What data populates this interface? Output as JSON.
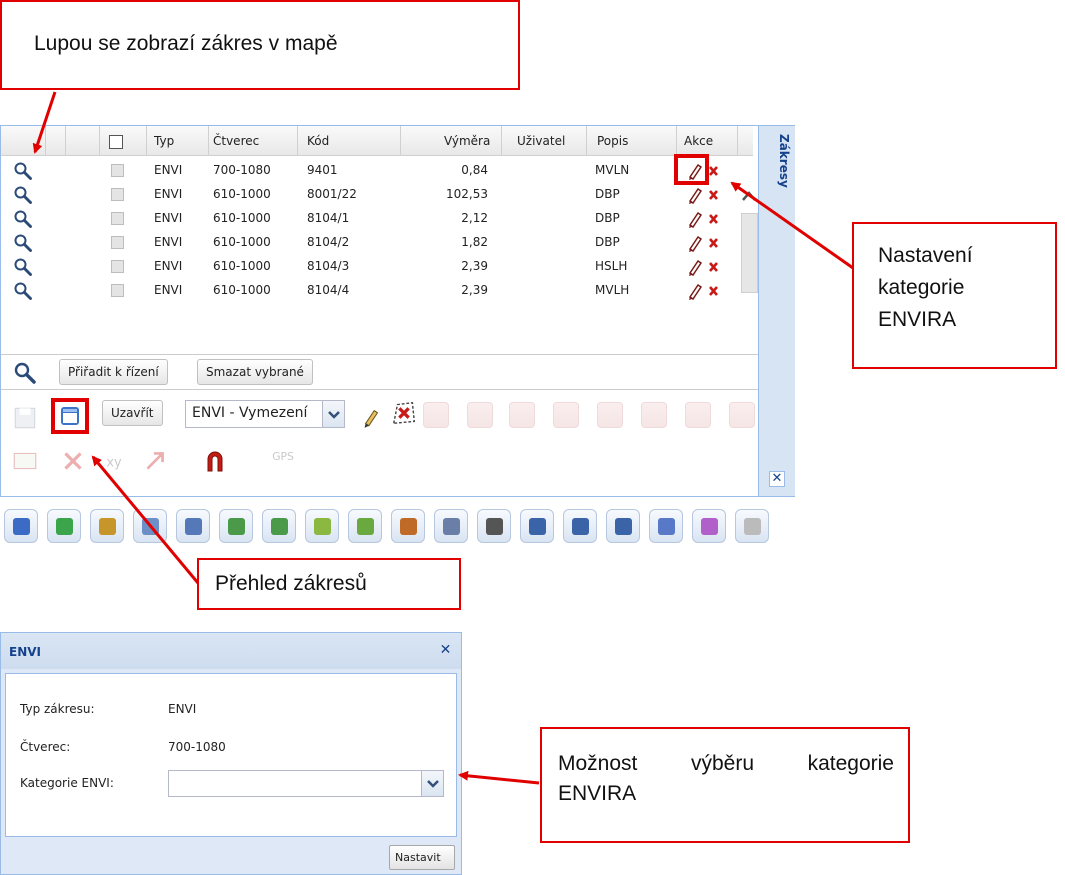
{
  "callouts": {
    "magnifier_note": "Lupou se zobrazí zákres v mapě",
    "category_note": [
      "Nastavení",
      "kategorie",
      "ENVIRA"
    ],
    "overview_note": "Přehled zákresů",
    "select_note": [
      "Možnost",
      "výběru",
      "kategorie",
      "ENVIRA"
    ]
  },
  "grid": {
    "columns": [
      "Typ",
      "Čtverec",
      "Kód",
      "Výměra",
      "Uživatel",
      "Popis",
      "Akce"
    ],
    "rows": [
      {
        "typ": "ENVI",
        "ctverec": "700-1080",
        "kod": "9401",
        "vymera": "0,84",
        "popis": "MVLN"
      },
      {
        "typ": "ENVI",
        "ctverec": "610-1000",
        "kod": "8001/22",
        "vymera": "102,53",
        "popis": "DBP"
      },
      {
        "typ": "ENVI",
        "ctverec": "610-1000",
        "kod": "8104/1",
        "vymera": "2,12",
        "popis": "DBP"
      },
      {
        "typ": "ENVI",
        "ctverec": "610-1000",
        "kod": "8104/2",
        "vymera": "1,82",
        "popis": "DBP"
      },
      {
        "typ": "ENVI",
        "ctverec": "610-1000",
        "kod": "8104/3",
        "vymera": "2,39",
        "popis": "HSLH"
      },
      {
        "typ": "ENVI",
        "ctverec": "610-1000",
        "kod": "8104/4",
        "vymera": "2,39",
        "popis": "MVLH"
      }
    ],
    "side_tab": "Zákresy",
    "toolbar": {
      "assign": "Přiřadit k řízení",
      "delete": "Smazat vybrané"
    },
    "edit": {
      "close": "Uzavřít",
      "type_select": "ENVI - Vymezení"
    }
  },
  "dialog": {
    "title": "ENVI",
    "fields": {
      "typ_label": "Typ zákresu:",
      "typ_value": "ENVI",
      "ctverec_label": "Čtverec:",
      "ctverec_value": "700-1080",
      "kategorie_label": "Kategorie ENVI:",
      "kategorie_value": ""
    },
    "set_button": "Nastavit"
  },
  "colors": {
    "callout_border": "#e00000",
    "panel_border": "#99bbe8",
    "title_text": "#15428b"
  },
  "icons": [
    "search-icon",
    "pencil-icon",
    "delete-icon",
    "save-icon",
    "overview-icon",
    "magnet-icon"
  ]
}
